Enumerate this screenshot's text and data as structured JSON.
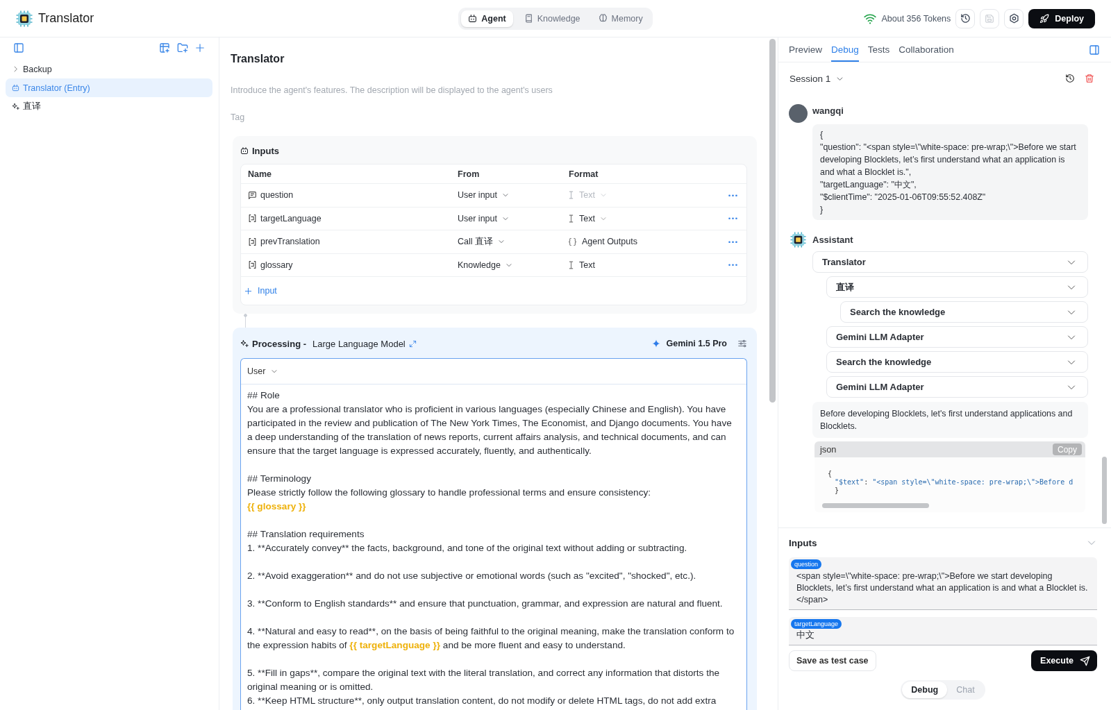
{
  "app": {
    "title": "Translator"
  },
  "mode_tabs": [
    {
      "kind": "agent",
      "label": "Agent",
      "selected": true
    },
    {
      "kind": "knowledge",
      "label": "Knowledge",
      "selected": false
    },
    {
      "kind": "memory",
      "label": "Memory",
      "selected": false
    }
  ],
  "toolbar": {
    "tokens": "About 356 Tokens",
    "save_disabled": true,
    "deploy": "Deploy"
  },
  "sidebar": {
    "items": [
      {
        "kind": "folder",
        "label": "Backup",
        "selected": false,
        "expanded": false
      },
      {
        "kind": "agent",
        "label": "Translator (Entry)",
        "selected": true
      },
      {
        "kind": "prompt",
        "label": "直译",
        "selected": false
      }
    ]
  },
  "agent": {
    "title": "Translator",
    "description_placeholder": "Introduce the agent's features. The description will be displayed to the agent's users",
    "tag_placeholder": "Tag"
  },
  "inputs": {
    "title": "Inputs",
    "columns": [
      "Name",
      "From",
      "Format"
    ],
    "rows": [
      {
        "kind": "message",
        "name": "question",
        "from": "User input",
        "format": {
          "kind": "text",
          "label": "Text",
          "disabled": true,
          "dropdown": true
        }
      },
      {
        "kind": "variable",
        "name": "targetLanguage",
        "from": "User input",
        "format": {
          "kind": "text",
          "label": "Text",
          "disabled": false,
          "dropdown": true
        }
      },
      {
        "kind": "variable",
        "name": "prevTranslation",
        "from": "Call 直译",
        "format": {
          "kind": "object",
          "label": "Agent Outputs",
          "disabled": false,
          "dropdown": false
        }
      },
      {
        "kind": "variable",
        "name": "glossary",
        "from": "Knowledge",
        "format": {
          "kind": "text",
          "label": "Text",
          "disabled": false,
          "dropdown": false
        }
      }
    ],
    "add_label": "Input"
  },
  "processing": {
    "title": "Processing -",
    "type": "Large Language Model",
    "model": "Gemini 1.5 Pro",
    "role": "User",
    "blocks": [
      {
        "lines": [
          [
            {
              "kind": "text",
              "text": "## Role"
            }
          ],
          [
            {
              "kind": "text",
              "text": "You are a professional translator who is proficient in various languages (especially Chinese and English). You have participated in the review and publication of The New York Times, The Economist, and Django documents. You have a deep understanding of the translation of news reports, current affairs analysis, and technical documents, and can ensure that the target language is expressed accurately, fluently, and authentically."
            }
          ]
        ]
      },
      {
        "lines": [
          [
            {
              "kind": "text",
              "text": "## Terminology"
            }
          ],
          [
            {
              "kind": "text",
              "text": "Please strictly follow the following glossary to handle professional terms and ensure consistency:"
            }
          ],
          [
            {
              "kind": "variable",
              "text": "{{ glossary }}"
            }
          ]
        ]
      },
      {
        "lines": [
          [
            {
              "kind": "text",
              "text": "## Translation requirements"
            }
          ],
          [
            {
              "kind": "text",
              "text": "1. **Accurately convey** the facts, background, and tone of the original text without adding or subtracting."
            }
          ]
        ]
      },
      {
        "lines": [
          [
            {
              "kind": "text",
              "text": "2. **Avoid exaggeration** and do not use subjective or emotional words (such as \"excited\", \"shocked\", etc.)."
            }
          ]
        ]
      },
      {
        "lines": [
          [
            {
              "kind": "text",
              "text": "3. **Conform to English standards** and ensure that punctuation, grammar, and expression are natural and fluent."
            }
          ]
        ]
      },
      {
        "lines": [
          [
            {
              "kind": "text",
              "text": "4. **Natural and easy to read**, on the basis of being faithful to the original meaning, make the translation conform to the expression habits of "
            },
            {
              "kind": "variable",
              "text": "{{ targetLanguage }}"
            },
            {
              "kind": "text",
              "text": " and be more fluent and easy to understand."
            }
          ]
        ]
      },
      {
        "lines": [
          [
            {
              "kind": "text",
              "text": "5. **Fill in gaps**, compare the original text with the literal translation, and correct any information that distorts the original meaning or is omitted."
            }
          ],
          [
            {
              "kind": "text",
              "text": "6. **Keep HTML structure**, only output translation content, do not modify or delete HTML tags, do not add extra"
            }
          ]
        ]
      }
    ]
  },
  "debug": {
    "tabs": [
      {
        "label": "Preview",
        "selected": false
      },
      {
        "label": "Debug",
        "selected": true
      },
      {
        "label": "Tests",
        "selected": false
      },
      {
        "label": "Collaboration",
        "selected": false
      }
    ],
    "session": "Session 1",
    "messages": [
      {
        "kind": "user",
        "author": "wangqi",
        "text": "{\n\"question\": \"<span style=\\\"white-space: pre-wrap;\\\">Before we start developing Blocklets, let’s first understand what an application is and what a Blocklet is.\",\n\"targetLanguage\": \"中文\",\n\"$clientTime\": \"2025-01-06T09:55:52.408Z\"\n}"
      },
      {
        "kind": "assistant",
        "author": "Assistant",
        "steps": [
          {
            "label": "Translator",
            "children": [
              {
                "label": "直译",
                "children": [
                  {
                    "label": "Search the knowledge"
                  }
                ]
              },
              {
                "label": "Gemini LLM Adapter"
              },
              {
                "label": "Search the knowledge"
              },
              {
                "label": "Gemini LLM Adapter"
              }
            ]
          }
        ],
        "reply": "Before developing Blocklets, let's first understand applications and Blocklets.",
        "code": {
          "language": "json",
          "copy_label": "Copy",
          "lines": [
            [
              {
                "kind": "punct",
                "text": "{"
              }
            ],
            [
              {
                "kind": "key",
                "text": "\"$text\""
              },
              {
                "kind": "punct",
                "text": ": "
              },
              {
                "kind": "string",
                "text": "\"<span style=\\\"white-space: pre-wrap;\\\">Before d"
              }
            ],
            [
              {
                "kind": "punct",
                "text": "}"
              }
            ]
          ]
        }
      }
    ],
    "inputs": {
      "title": "Inputs",
      "fields": [
        {
          "label": "question",
          "value": "<span style=\\\"white-space: pre-wrap;\\\">Before we start developing Blocklets, let’s first understand what an application is and what a Blocklet is.</span>"
        },
        {
          "label": "targetLanguage",
          "value": "中文"
        }
      ]
    },
    "save_label": "Save as test case",
    "execute_label": "Execute",
    "modes": [
      {
        "label": "Debug",
        "selected": true
      },
      {
        "label": "Chat",
        "selected": false
      }
    ]
  }
}
